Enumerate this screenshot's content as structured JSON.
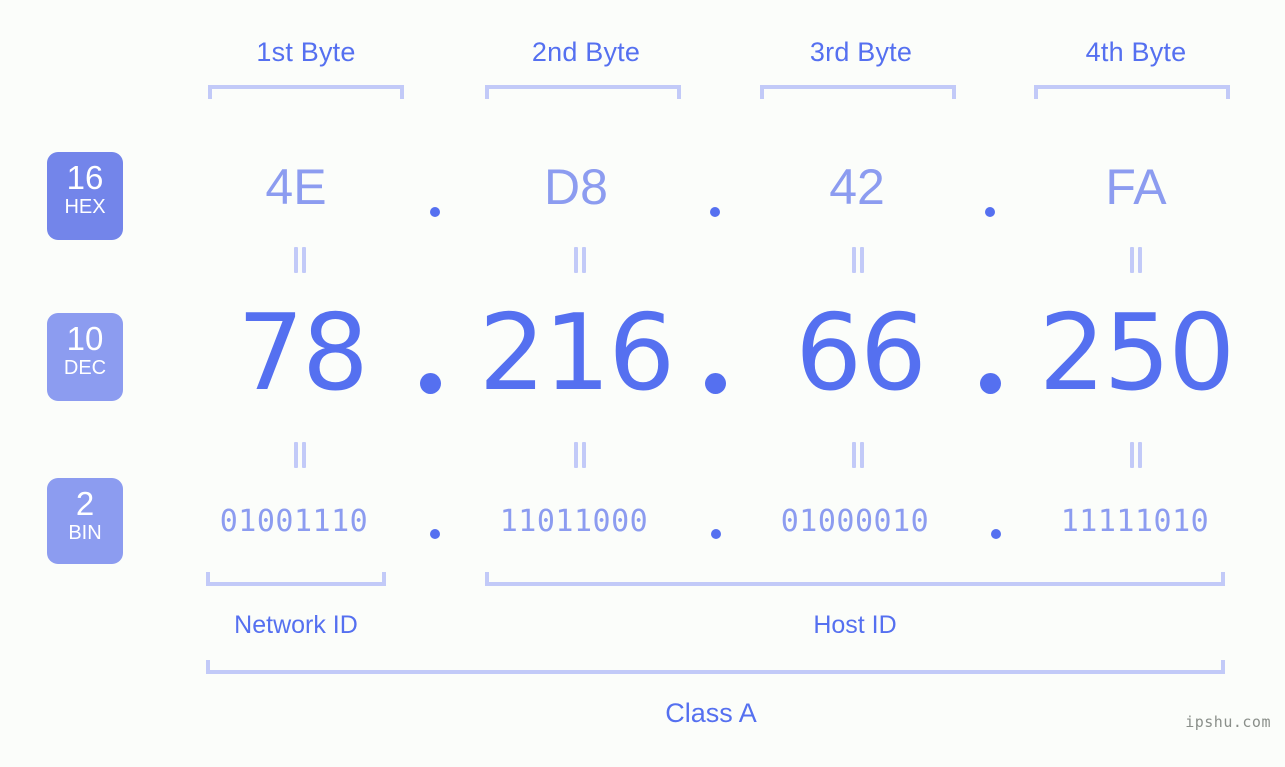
{
  "watermark": "ipshu.com",
  "byte_headers": [
    {
      "label": "1st Byte"
    },
    {
      "label": "2nd Byte"
    },
    {
      "label": "3rd Byte"
    },
    {
      "label": "4th Byte"
    }
  ],
  "rows": {
    "hex": {
      "base": "16",
      "abbr": "HEX",
      "values": [
        "4E",
        "D8",
        "42",
        "FA"
      ],
      "separator": "."
    },
    "dec": {
      "base": "10",
      "abbr": "DEC",
      "values": [
        "78",
        "216",
        "66",
        "250"
      ],
      "separator": "."
    },
    "bin": {
      "base": "2",
      "abbr": "BIN",
      "values": [
        "01001110",
        "11011000",
        "01000010",
        "11111010"
      ],
      "separator": "."
    }
  },
  "equivalence_mark": "=",
  "sections": {
    "network_id": "Network ID",
    "host_id": "Host ID",
    "class": "Class A"
  },
  "colors": {
    "background": "#fbfdfa",
    "accent_strong": "#5570f0",
    "accent_light": "#8c9cf0",
    "bracket": "#c2caf8",
    "badge_hex": "#7385ea",
    "badge_dec": "#8c9cf0",
    "badge_bin": "#8c9cf0",
    "watermark": "#8a8f8a"
  }
}
